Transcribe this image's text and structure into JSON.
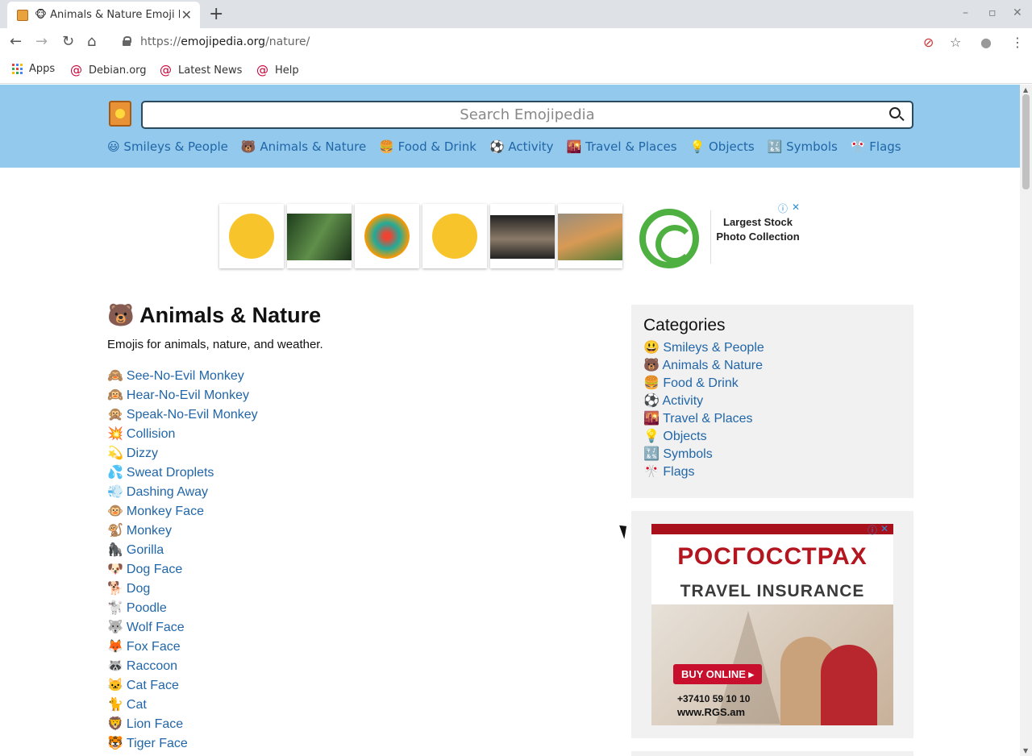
{
  "browser": {
    "tab_title": "🐵 Animals & Nature Emoji Meanings",
    "url_prefix": "https://",
    "url_host": "emojipedia.org",
    "url_path": "/nature/",
    "bookmarks": [
      "Apps",
      "Debian.org",
      "Latest News",
      "Help"
    ],
    "window_controls": [
      "–",
      "▫",
      "✕"
    ]
  },
  "site": {
    "search_placeholder": "Search Emojipedia",
    "nav": [
      {
        "glyph": "😃",
        "label": "Smileys & People"
      },
      {
        "glyph": "🐻",
        "label": "Animals & Nature"
      },
      {
        "glyph": "🍔",
        "label": "Food & Drink"
      },
      {
        "glyph": "⚽",
        "label": "Activity"
      },
      {
        "glyph": "🌇",
        "label": "Travel & Places"
      },
      {
        "glyph": "💡",
        "label": "Objects"
      },
      {
        "glyph": "🔣",
        "label": "Symbols"
      },
      {
        "glyph": "🎌",
        "label": "Flags"
      }
    ]
  },
  "top_ad": {
    "text": "Largest Stock Photo Collection",
    "badge": "ⓘ",
    "close": "✕"
  },
  "main": {
    "title_glyph": "🐻",
    "title": "Animals & Nature",
    "description": "Emojis for animals, nature, and weather.",
    "items": [
      {
        "glyph": "🙈",
        "label": "See-No-Evil Monkey"
      },
      {
        "glyph": "🙉",
        "label": "Hear-No-Evil Monkey"
      },
      {
        "glyph": "🙊",
        "label": "Speak-No-Evil Monkey"
      },
      {
        "glyph": "💥",
        "label": "Collision"
      },
      {
        "glyph": "💫",
        "label": "Dizzy"
      },
      {
        "glyph": "💦",
        "label": "Sweat Droplets"
      },
      {
        "glyph": "💨",
        "label": "Dashing Away"
      },
      {
        "glyph": "🐵",
        "label": "Monkey Face"
      },
      {
        "glyph": "🐒",
        "label": "Monkey"
      },
      {
        "glyph": "🦍",
        "label": "Gorilla"
      },
      {
        "glyph": "🐶",
        "label": "Dog Face"
      },
      {
        "glyph": "🐕",
        "label": "Dog"
      },
      {
        "glyph": "🐩",
        "label": "Poodle"
      },
      {
        "glyph": "🐺",
        "label": "Wolf Face"
      },
      {
        "glyph": "🦊",
        "label": "Fox Face"
      },
      {
        "glyph": "🦝",
        "label": "Raccoon"
      },
      {
        "glyph": "🐱",
        "label": "Cat Face"
      },
      {
        "glyph": "🐈",
        "label": "Cat"
      },
      {
        "glyph": "🦁",
        "label": "Lion Face"
      },
      {
        "glyph": "🐯",
        "label": "Tiger Face"
      }
    ]
  },
  "sidebar": {
    "heading": "Categories",
    "items": [
      {
        "glyph": "😃",
        "label": "Smileys & People"
      },
      {
        "glyph": "🐻",
        "label": "Animals & Nature"
      },
      {
        "glyph": "🍔",
        "label": "Food & Drink"
      },
      {
        "glyph": "⚽",
        "label": "Activity"
      },
      {
        "glyph": "🌇",
        "label": "Travel & Places"
      },
      {
        "glyph": "💡",
        "label": "Objects"
      },
      {
        "glyph": "🔣",
        "label": "Symbols"
      },
      {
        "glyph": "🎌",
        "label": "Flags"
      }
    ]
  },
  "side_ad": {
    "brand": "РОСГОССТРАХ",
    "subtitle": "TRAVEL INSURANCE",
    "button": "BUY ONLINE ▸",
    "phone": "+37410 59 10 10",
    "site": "www.RGS.am",
    "badge": "ⓘ",
    "close": "✕"
  }
}
